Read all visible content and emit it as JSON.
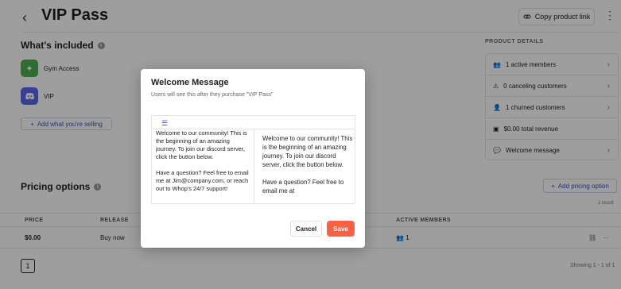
{
  "header": {
    "back_glyph": "‹",
    "title": "VIP Pass",
    "copy_label": "Copy product link",
    "more_glyph": "⋮"
  },
  "included": {
    "title": "What's included",
    "items": [
      {
        "label": "Gym Access",
        "icon": "sparkle-icon",
        "color": "#4caf50"
      },
      {
        "label": "VIP",
        "icon": "discord-icon",
        "color": "#5865f2"
      }
    ],
    "add_label": "Add what you're selling"
  },
  "product_details": {
    "title": "PRODUCT DETAILS",
    "rows": [
      {
        "label": "1 active members",
        "icon": "users-icon"
      },
      {
        "label": "0 canceling customers",
        "icon": "warning-icon"
      },
      {
        "label": "1 churned customers",
        "icon": "user-minus-icon"
      },
      {
        "label": "$0.00 total revenue",
        "icon": "cash-icon"
      },
      {
        "label": "Welcome message",
        "icon": "chat-icon"
      }
    ]
  },
  "pricing": {
    "title": "Pricing options",
    "add_label": "Add pricing option",
    "result_count": "1 result",
    "columns": [
      "PRICE",
      "RELEASE",
      "ACTIVE MEMBERS"
    ],
    "row": {
      "price": "$0.00",
      "release": "Buy now",
      "members": "1"
    },
    "page": "1",
    "showing": "Showing 1 - 1 of 1"
  },
  "modal": {
    "title": "Welcome Message",
    "subtitle": "Users will see this after they purchase \"VIP Pass\"",
    "editor_text": "Welcome to our community! This is the beginning of an amazing journey. To join our discord server, click the button below.\n\nHave a question? Feel free to email me at Jim@company.com, or reach out to Whop's 24/7 support!",
    "preview_text": "Welcome to our community! This is the beginning of an amazing journey. To join our discord server, click the button below.\n\nHave a question? Feel free to email me at",
    "cancel_label": "Cancel",
    "save_label": "Save"
  }
}
